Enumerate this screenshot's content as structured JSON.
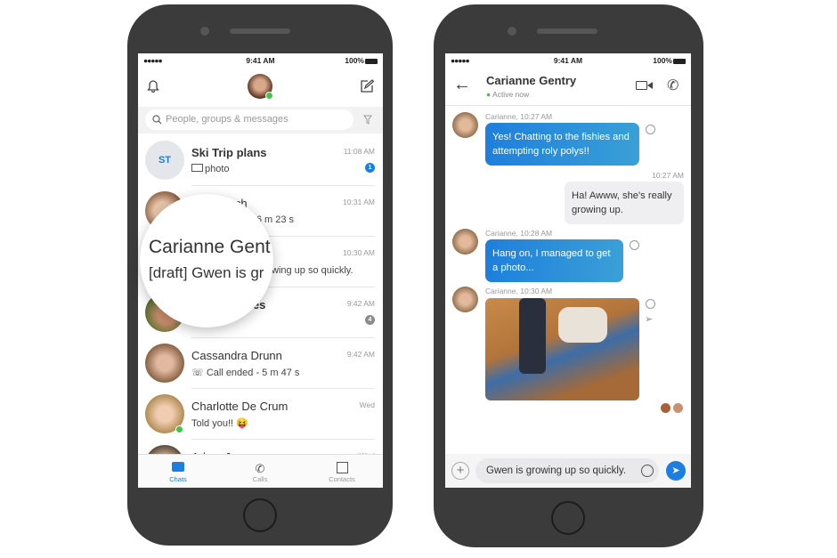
{
  "status_bar": {
    "signal": "●●●●●",
    "time": "9:41 AM",
    "battery": "100%"
  },
  "chat_list": {
    "search_placeholder": "People, groups & messages",
    "rows": [
      {
        "initials": "ST",
        "name": "Ski Trip plans",
        "preview": "photo",
        "time": "11:08 AM",
        "badge": "1",
        "badge_color": "#1a7fe0"
      },
      {
        "name": "Roach",
        "preview": "- 26 m 23 s",
        "time": "10:31 AM"
      },
      {
        "name": "Carianne Gentry",
        "preview": "wing up so quickly.",
        "time": "10:30 AM"
      },
      {
        "name": "ales",
        "time": "9:42 AM",
        "badge": "4",
        "badge_color": "#8a8a8a"
      },
      {
        "name": "Cassandra Drunn",
        "preview": "Call ended - 5 m 47 s",
        "time": "9:42 AM"
      },
      {
        "name": "Charlotte De Crum",
        "preview": "Told you!!",
        "time": "Wed",
        "emoji": "😝"
      },
      {
        "name": "Adam Jerman",
        "time": "Wed"
      }
    ],
    "magnifier": {
      "name": "Carianne Gent",
      "draft": "[draft] Gwen is gr"
    },
    "tabs": [
      {
        "label": "Chats",
        "active": true
      },
      {
        "label": "Calls"
      },
      {
        "label": "Contacts"
      }
    ]
  },
  "conversation": {
    "contact_name": "Carianne Gentry",
    "presence": "Active now",
    "messages": [
      {
        "sender": "Carianne, 10:27 AM",
        "text": "Yes! Chatting to the fishies and attempting roly polys!!",
        "dir": "in"
      },
      {
        "sender": "10:27 AM",
        "text": "Ha! Awww, she's really growing up.",
        "dir": "out"
      },
      {
        "sender": "Carianne, 10:28 AM",
        "text": "Hang on, I managed to get a photo...",
        "dir": "in"
      },
      {
        "sender": "Carianne, 10:30 AM",
        "type": "photo",
        "dir": "in"
      }
    ],
    "composer_value": "Gwen is growing up so quickly."
  },
  "colors": {
    "accent": "#1a7fe0",
    "online": "#3cc84a",
    "phone_body": "#3b3b3b"
  }
}
